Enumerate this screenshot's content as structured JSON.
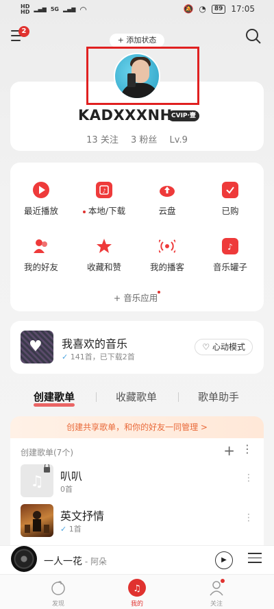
{
  "status_bar": {
    "time": "17:05",
    "battery": "89",
    "network": "5G"
  },
  "header": {
    "menu_badge": "2",
    "add_status": "+ 添加状态"
  },
  "profile": {
    "username": "KADXXXNH",
    "vip_badge": "CVIP·壹",
    "follows": "13 关注",
    "fans": "3 粉丝",
    "level": "Lv.9"
  },
  "apps": [
    {
      "label": "最近播放",
      "icon": "play-icon"
    },
    {
      "label": "本地/下载",
      "icon": "download-icon",
      "dot": true
    },
    {
      "label": "云盘",
      "icon": "cloud-upload-icon"
    },
    {
      "label": "已购",
      "icon": "bag-check-icon"
    },
    {
      "label": "我的好友",
      "icon": "friends-icon"
    },
    {
      "label": "收藏和赞",
      "icon": "star-icon"
    },
    {
      "label": "我的播客",
      "icon": "broadcast-icon"
    },
    {
      "label": "音乐罐子",
      "icon": "music-jar-icon"
    }
  ],
  "music_apps": "+ 音乐应用",
  "favorites": {
    "title": "我喜欢的音乐",
    "subtitle": "141首，已下载2首",
    "heart_mode": "心动模式"
  },
  "tabs": [
    {
      "label": "创建歌单",
      "active": true
    },
    {
      "label": "收藏歌单",
      "active": false
    },
    {
      "label": "歌单助手",
      "active": false
    }
  ],
  "share_banner": "创建共享歌单，和你的好友一同管理 >",
  "playlists": {
    "header": "创建歌单(7个)",
    "items": [
      {
        "name": "叭叭",
        "count": "0首"
      },
      {
        "name": "英文抒情",
        "count": "1首"
      }
    ]
  },
  "player": {
    "title": "一人一花",
    "artist": " - 阿朵"
  },
  "bottom_nav": [
    {
      "label": "发现",
      "active": false
    },
    {
      "label": "我的",
      "active": true
    },
    {
      "label": "关注",
      "active": false
    }
  ],
  "colors": {
    "accent": "#e0322f",
    "highlight_box": "#e02020"
  }
}
